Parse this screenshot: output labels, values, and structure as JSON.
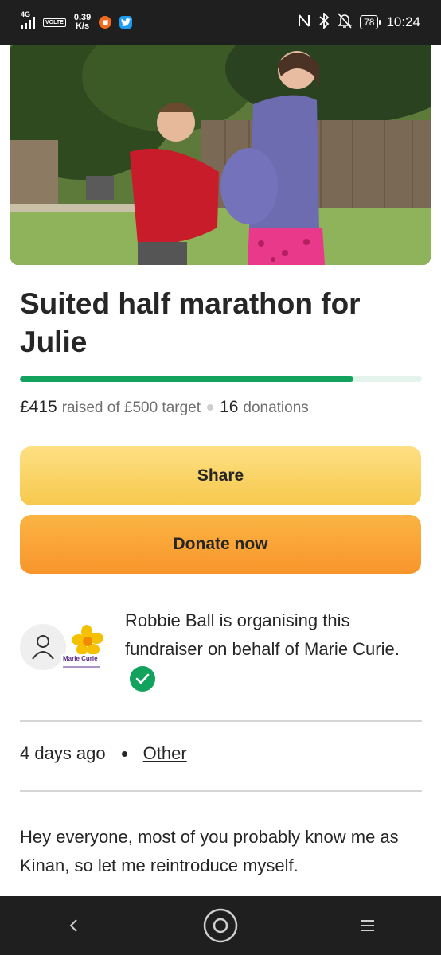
{
  "status_bar": {
    "network_type": "4G",
    "volte_label": "VOLTE",
    "speed_value": "0.39",
    "speed_unit": "K/s",
    "battery_level": "78",
    "time": "10:24",
    "icons": [
      "signal-icon",
      "volte-icon",
      "app-notification-icon",
      "twitter-icon",
      "nfc-icon",
      "bluetooth-icon",
      "mute-icon",
      "battery-icon"
    ]
  },
  "fundraiser": {
    "title": "Suited half marathon for Julie",
    "progress_fraction": 0.83,
    "raised_amount": "£415",
    "raised_of_text": "raised of £500 target",
    "donations_count": "16",
    "donations_label": "donations"
  },
  "actions": {
    "share_label": "Share",
    "donate_label": "Donate now"
  },
  "organiser": {
    "text": "Robbie Ball is organising this fundraiser on behalf of Marie Curie.",
    "charity_logo_text": "Marie Curie"
  },
  "meta": {
    "posted": "4 days ago",
    "category_link": "Other"
  },
  "story": {
    "intro": "Hey everyone, most of you probably know me as Kinan, so let me reintroduce myself."
  },
  "colors": {
    "progress_green": "#11a35d",
    "share_yellow": "#f7c84d",
    "donate_orange": "#f8952b",
    "status_bar_bg": "#1f1f1f"
  }
}
